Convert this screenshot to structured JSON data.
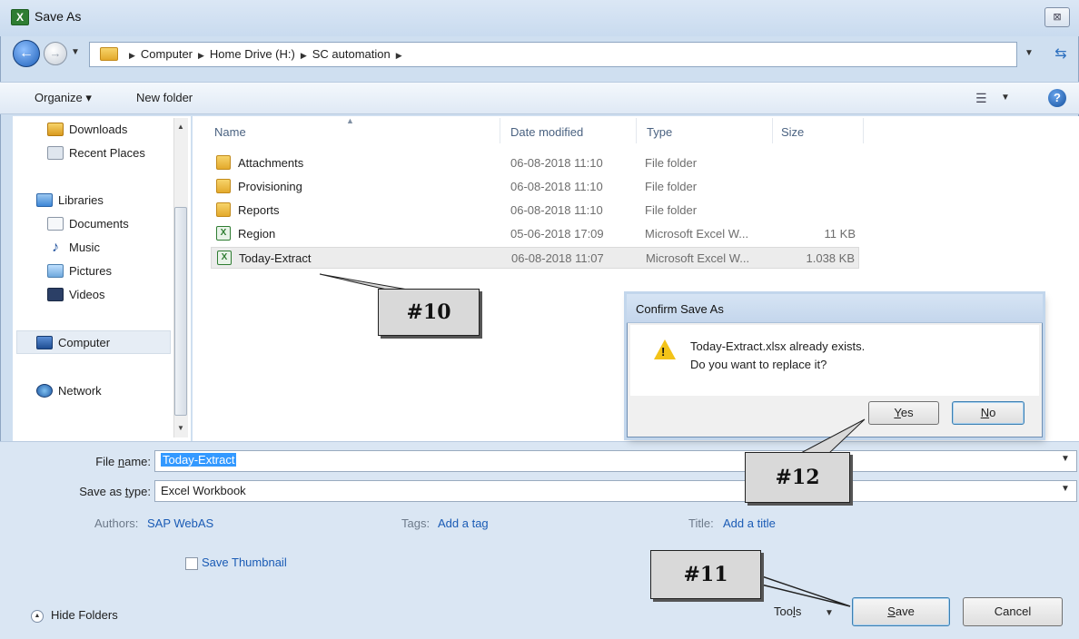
{
  "window": {
    "title": "Save As",
    "app_icon": "X",
    "close_symbol": "⊠"
  },
  "address": {
    "breadcrumb": [
      "Computer",
      "Home Drive (H:)",
      "SC automation"
    ]
  },
  "toolbar": {
    "organize_label": "Organize ▾",
    "new_folder_label": "New folder"
  },
  "sidebar": {
    "items": [
      {
        "label": "Downloads",
        "icon": "downloads-icon"
      },
      {
        "label": "Recent Places",
        "icon": "recent-places-icon"
      },
      {
        "label": "Libraries",
        "icon": "libraries-icon"
      },
      {
        "label": "Documents",
        "icon": "documents-icon"
      },
      {
        "label": "Music",
        "icon": "music-icon"
      },
      {
        "label": "Pictures",
        "icon": "pictures-icon"
      },
      {
        "label": "Videos",
        "icon": "videos-icon"
      },
      {
        "label": "Computer",
        "icon": "computer-icon"
      },
      {
        "label": "Network",
        "icon": "network-icon"
      }
    ]
  },
  "file_list": {
    "columns": [
      "Name",
      "Date modified",
      "Type",
      "Size"
    ],
    "rows": [
      {
        "name": "Attachments",
        "date": "06-08-2018 11:10",
        "type": "File folder",
        "size": "",
        "icon": "folder-icon"
      },
      {
        "name": "Provisioning",
        "date": "06-08-2018 11:10",
        "type": "File folder",
        "size": "",
        "icon": "folder-icon"
      },
      {
        "name": "Reports",
        "date": "06-08-2018 11:10",
        "type": "File folder",
        "size": "",
        "icon": "folder-icon"
      },
      {
        "name": "Region",
        "date": "05-06-2018 17:09",
        "type": "Microsoft Excel W...",
        "size": "11 KB",
        "icon": "excel-file-icon"
      },
      {
        "name": "Today-Extract",
        "date": "06-08-2018 11:07",
        "type": "Microsoft Excel W...",
        "size": "1.038 KB",
        "icon": "excel-file-icon",
        "selected": true
      }
    ]
  },
  "form": {
    "filename_label_pre": "File ",
    "filename_label_ul": "n",
    "filename_label_post": "ame:",
    "filename_value": "Today-Extract",
    "savetype_label_pre": "Save as ",
    "savetype_label_ul": "t",
    "savetype_label_post": "ype:",
    "savetype_value": "Excel Workbook",
    "authors_label": "Authors:",
    "authors_value": "SAP WebAS",
    "tags_label": "Tags:",
    "tags_value": "Add a tag",
    "title_label": "Title:",
    "title_value": "Add a title",
    "thumbnail_label": "Save Thumbnail"
  },
  "footer": {
    "hide_folders_label": "Hide Folders",
    "tools_pre": "Too",
    "tools_ul": "l",
    "tools_post": "s",
    "save_ul": "S",
    "save_rest": "ave",
    "cancel_label": "Cancel"
  },
  "confirm_dialog": {
    "title": "Confirm Save As",
    "message_line1": "Today-Extract.xlsx already exists.",
    "message_line2": "Do you want to replace it?",
    "yes_ul": "Y",
    "yes_rest": "es",
    "no_ul": "N",
    "no_rest": "o"
  },
  "callouts": {
    "c10": "#10",
    "c11": "#11",
    "c12": "#12"
  },
  "colors": {
    "accent_selection": "#3399ff",
    "link": "#1a5bb5",
    "frame": "#cfdff0",
    "warning": "#f3c318"
  }
}
